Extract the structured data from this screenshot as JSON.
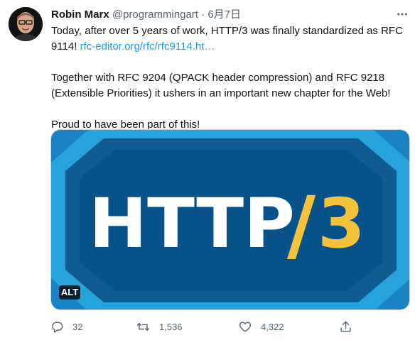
{
  "tweet": {
    "author_name": "Robin Marx",
    "handle": "@programmingart",
    "separator": "·",
    "date": "6月7日",
    "text_line1": "Today, after over 5 years of work, HTTP/3 was finally standardized as RFC 9114!",
    "link_text": "rfc-editor.org/rfc/rfc9114.ht…",
    "paragraph2": "Together with RFC 9204 (QPACK header compression) and RFC 9218 (Extensible Priorities) it ushers in an important new chapter for the Web!",
    "paragraph3": "Proud to have been part of this!"
  },
  "media": {
    "logo_main": "HTTP",
    "logo_slash": "/",
    "logo_version": "3",
    "alt_label": "ALT",
    "colors": {
      "outer_bg": "#1b83c4",
      "light_band": "#27a3dc",
      "dark_band": "#0f5b92",
      "inner": "#07528a",
      "accent": "#f5c33b"
    }
  },
  "actions": {
    "reply_count": "32",
    "retweet_count": "1,536",
    "like_count": "4,322"
  },
  "icons": [
    "avatar",
    "more-icon",
    "reply-icon",
    "retweet-icon",
    "like-icon",
    "share-icon"
  ]
}
